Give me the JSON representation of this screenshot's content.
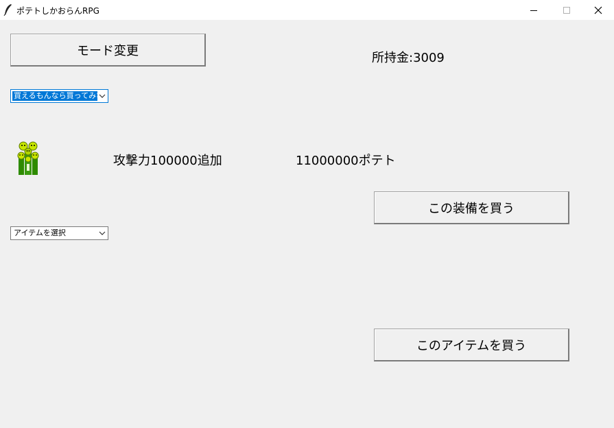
{
  "window": {
    "title": "ポテトしかおらんRPG"
  },
  "toolbar": {
    "mode_button_label": "モード変更"
  },
  "status": {
    "money_text": "所持金:3009"
  },
  "equipment": {
    "selected": "買えるもんなら買ってみな",
    "effect_text": "攻撃力100000追加",
    "price_text": "11000000ポテト",
    "buy_button_label": "この装備を買う",
    "image_icon": "potato-stack-icon"
  },
  "item": {
    "selected": "アイテムを選択",
    "buy_button_label": "このアイテムを買う"
  },
  "colors": {
    "background": "#f0f0f0",
    "selection": "#0078d7",
    "potato_green": "#2e8b00",
    "potato_yellow": "#c8e600"
  }
}
